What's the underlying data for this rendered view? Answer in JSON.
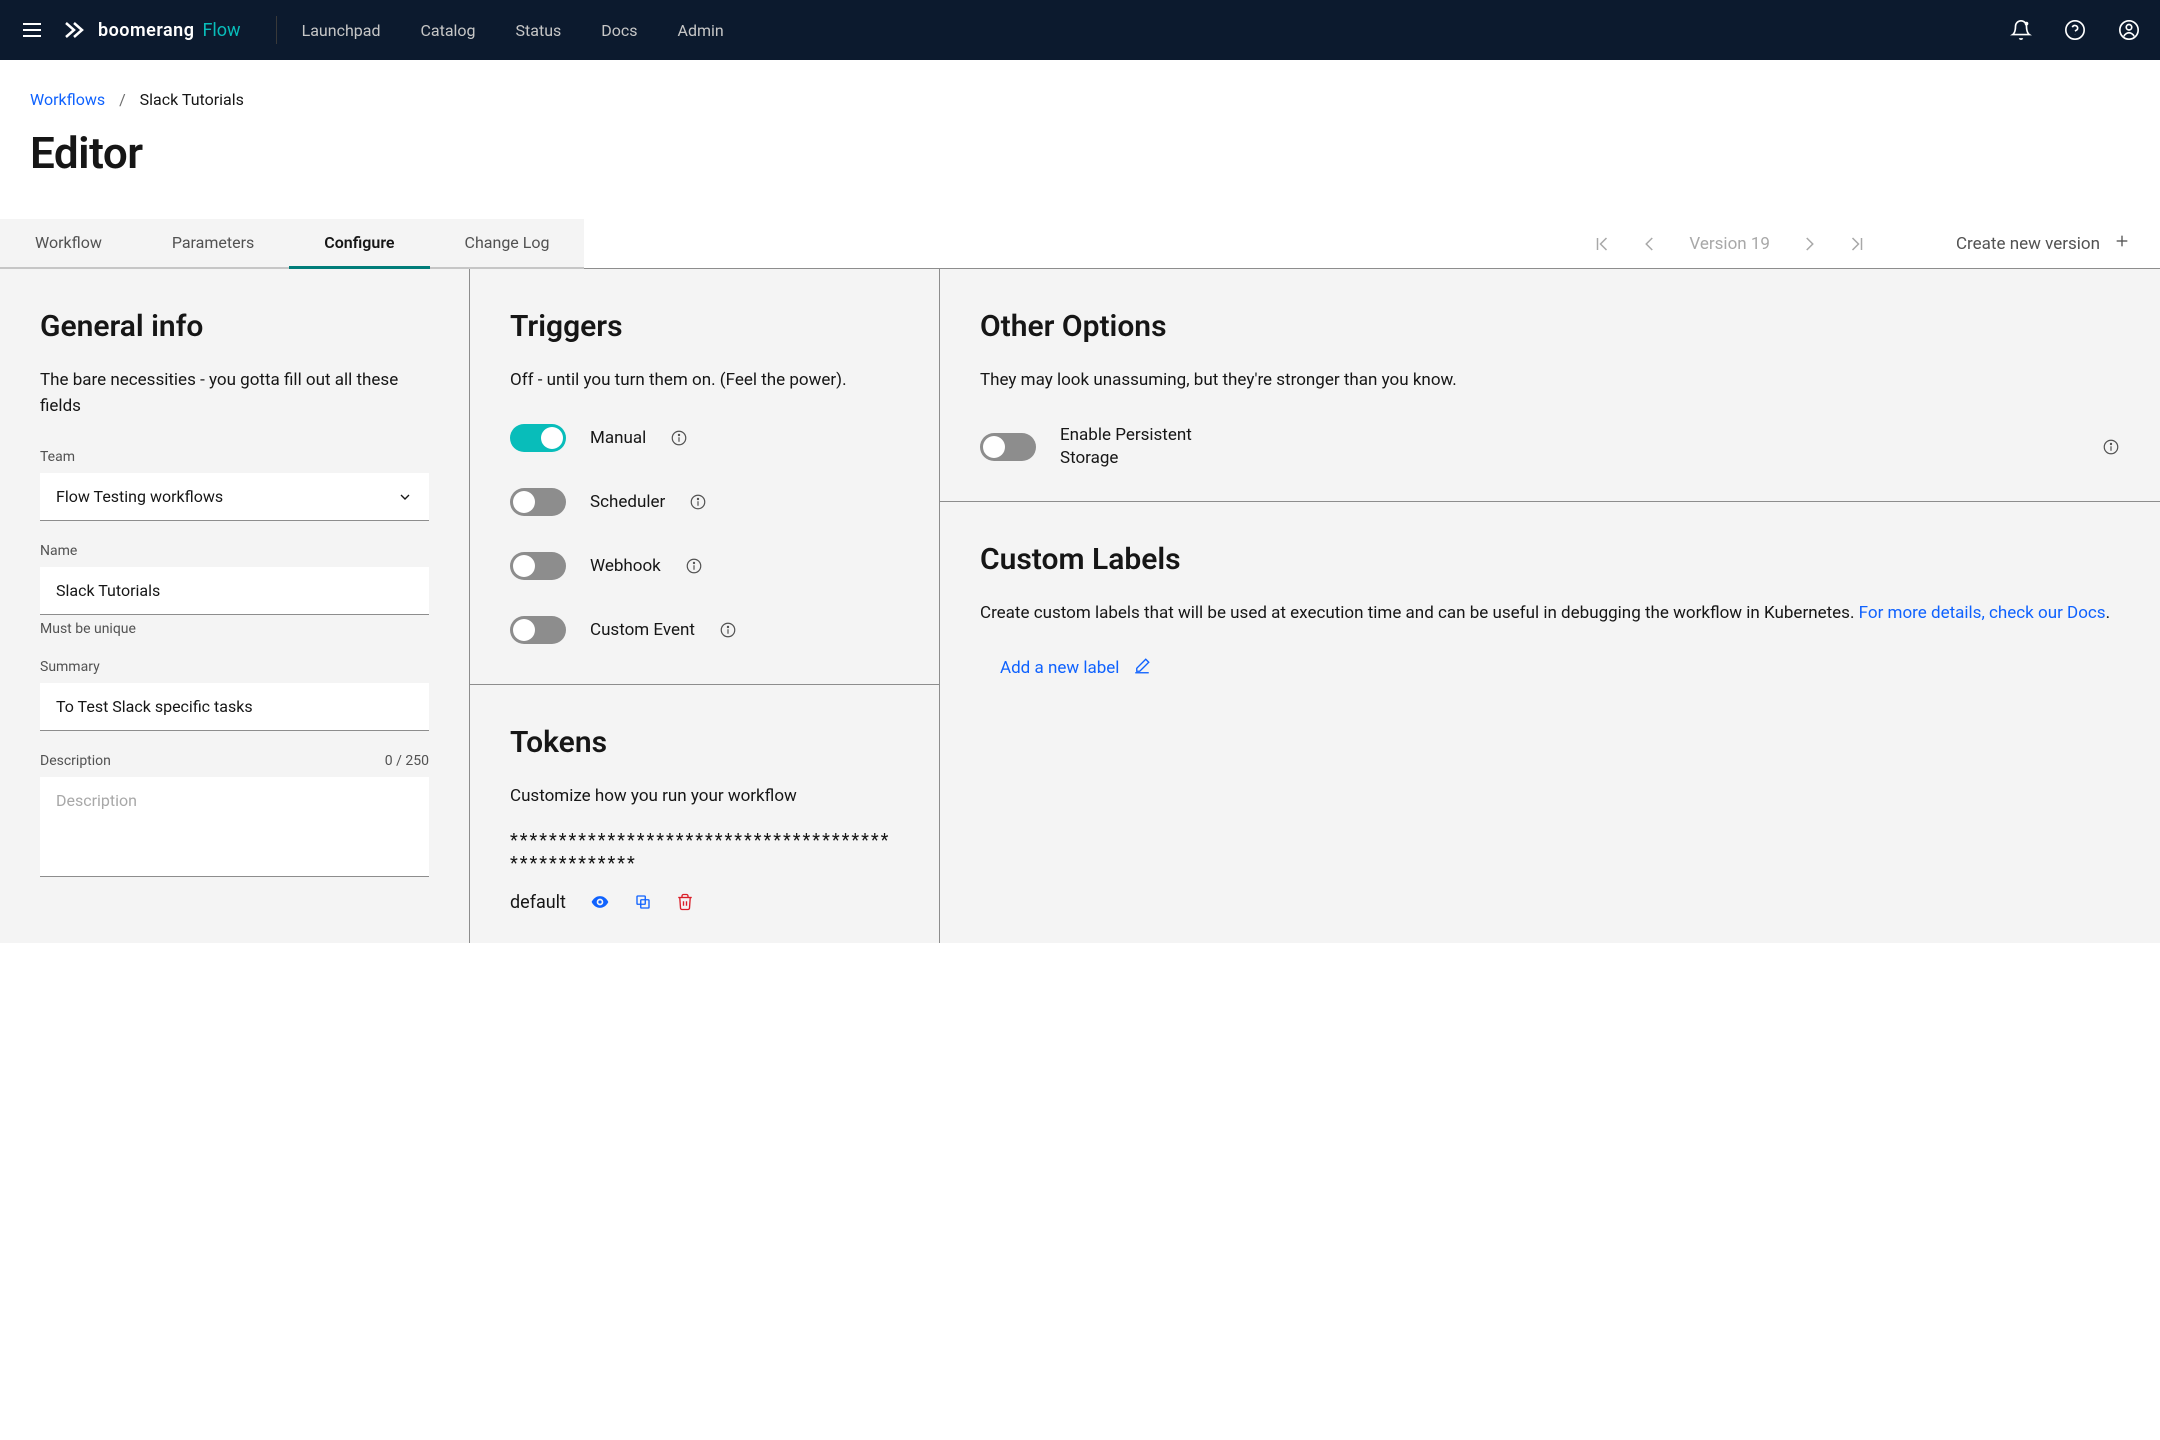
{
  "header": {
    "brand": "boomerang",
    "product": "Flow",
    "nav": [
      "Launchpad",
      "Catalog",
      "Status",
      "Docs",
      "Admin"
    ]
  },
  "breadcrumb": {
    "root": "Workflows",
    "current": "Slack Tutorials"
  },
  "pageTitle": "Editor",
  "tabs": [
    "Workflow",
    "Parameters",
    "Configure",
    "Change Log"
  ],
  "activeTab": "Configure",
  "version": {
    "label": "Version 19",
    "create": "Create new version"
  },
  "generalInfo": {
    "heading": "General info",
    "desc": "The bare necessities - you gotta fill out all these fields",
    "teamLabel": "Team",
    "teamValue": "Flow Testing workflows",
    "nameLabel": "Name",
    "nameValue": "Slack Tutorials",
    "nameHelper": "Must be unique",
    "summaryLabel": "Summary",
    "summaryValue": "To Test Slack specific tasks",
    "descriptionLabel": "Description",
    "descriptionCounter": "0 / 250",
    "descriptionPlaceholder": "Description"
  },
  "triggers": {
    "heading": "Triggers",
    "desc": "Off - until you turn them on. (Feel the power).",
    "items": [
      {
        "label": "Manual",
        "on": true
      },
      {
        "label": "Scheduler",
        "on": false
      },
      {
        "label": "Webhook",
        "on": false
      },
      {
        "label": "Custom Event",
        "on": false
      }
    ]
  },
  "tokens": {
    "heading": "Tokens",
    "desc": "Customize how you run your workflow",
    "mask": "****************************************************",
    "rowLabel": "default"
  },
  "otherOptions": {
    "heading": "Other Options",
    "desc": "They may look unassuming, but they're stronger than you know.",
    "persistentLabel": "Enable Persistent Storage"
  },
  "customLabels": {
    "heading": "Custom Labels",
    "desc": "Create custom labels that will be used at execution time and can be useful in debugging the workflow in Kubernetes. ",
    "docsLink": "For more details, check our Docs",
    "period": ".",
    "addLabel": "Add a new label"
  }
}
